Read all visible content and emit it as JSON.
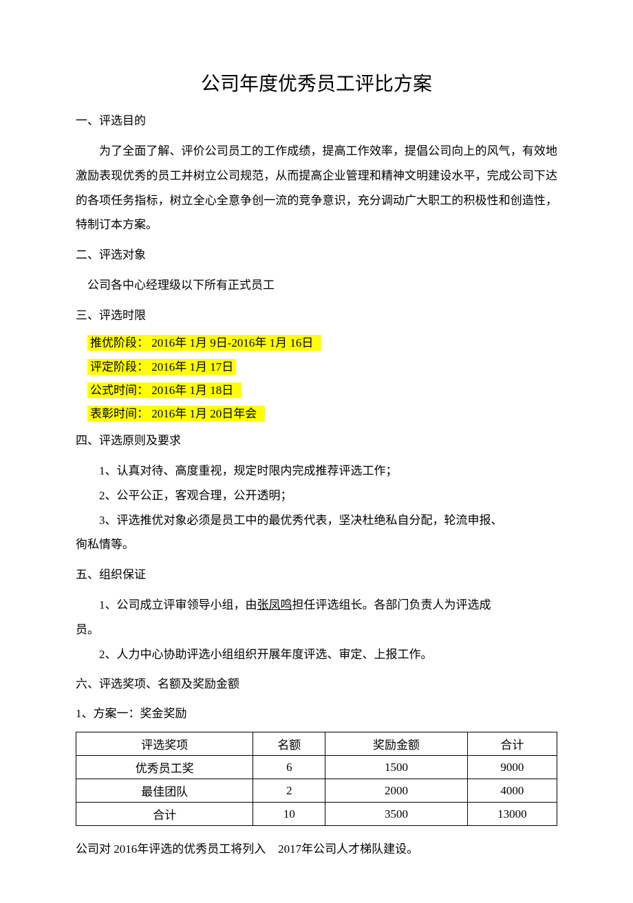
{
  "title": "公司年度优秀员工评比方案",
  "s1_head": "一、评选目的",
  "s1_para": "为了全面了解、评价公司员工的工作成绩，提高工作效率，提倡公司向上的风气，有效地激励表现优秀的员工并树立公司规范，从而提高企业管理和精神文明建设水平，完成公司下达的各项任务指标，树立全心全意争创一流的竞争意识，充分调动广大职工的积极性和创造性，特制订本方案。",
  "s2_head": "二、评选对象",
  "s2_para": "公司各中心经理级以下所有正式员工",
  "s3_head": "三、评选时限",
  "s3_line1": " 推优阶段： 2016年 1月 9日-2016年  1月 16日 ",
  "s3_line2": " 评定阶段： 2016年 1月 17日 ",
  "s3_line3": " 公式时间： 2016年 1月 18日 ",
  "s3_line4": " 表彰时间： 2016年 1月 20日年会 ",
  "s4_head": "四、评选原则及要求",
  "s4_i1": "1、认真对待、高度重视，规定时限内完成推荐评选工作；",
  "s4_i2": "2、公平公正，客观合理，公开透明；",
  "s4_i3a": "3、评选推优对象必须是员工中的最优秀代表，坚决杜绝私自分配，轮流申报、",
  "s4_i3b": "徇私情等。",
  "s5_head": "五、组织保证",
  "s5_i1a": "1、公司成立评审领导小组，由",
  "s5_i1_name": "张凤鸣",
  "s5_i1b": "担任评选组长。各部门负责人为评选成",
  "s5_i1c": "员。",
  "s5_i2": "2、人力中心协助评选小组组织开展年度评选、审定、上报工作。",
  "s6_head": "六、评选奖项、名额及奖励金额",
  "s6_sub": "1、方案一：奖金奖励",
  "table": {
    "h": [
      "评选奖项",
      "名额",
      "奖励金额",
      "合计"
    ],
    "r1": [
      "优秀员工奖",
      "6",
      "1500",
      "9000"
    ],
    "r2": [
      "最佳团队",
      "2",
      "2000",
      "4000"
    ],
    "r3": [
      "合计",
      "10",
      "3500",
      "13000"
    ]
  },
  "footer_a": "公司对 2016年评选的优秀员工将列入",
  "footer_b": " 2017年公司人才梯队建设。"
}
